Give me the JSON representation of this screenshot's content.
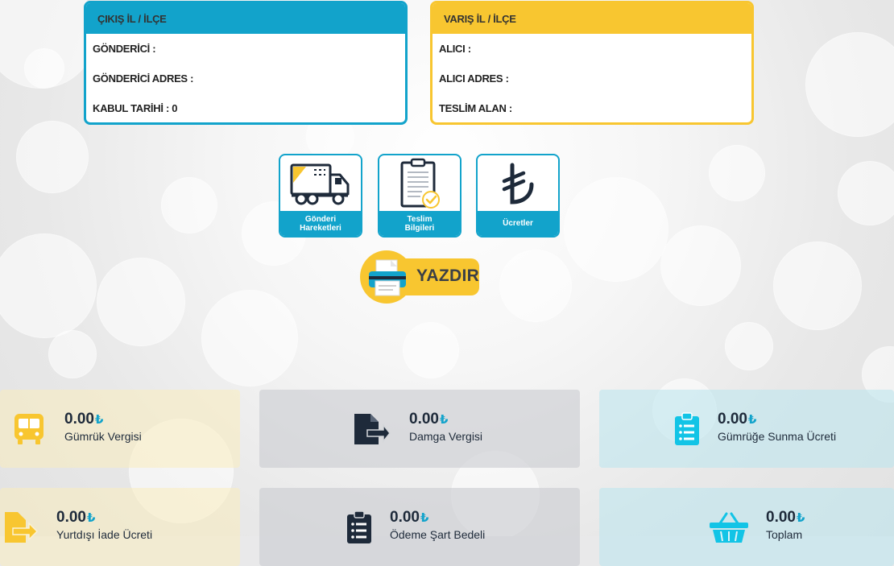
{
  "origin": {
    "header": "ÇIKIŞ İL / İLÇE",
    "rows": [
      "GÖNDERİCİ :",
      "GÖNDERİCİ ADRES :",
      "KABUL TARİHİ : 0"
    ]
  },
  "destination": {
    "header": "VARIŞ İL / İLÇE",
    "rows": [
      "ALICI :",
      "ALICI ADRES :",
      "TESLİM ALAN :"
    ]
  },
  "actions": [
    {
      "label_line1": "Gönderi",
      "label_line2": "Hareketleri",
      "icon": "truck-icon"
    },
    {
      "label_line1": "Teslim",
      "label_line2": "Bilgileri",
      "icon": "clipboard-check-icon"
    },
    {
      "label_line1": "Ücretler",
      "label_line2": "",
      "icon": "lira-icon"
    }
  ],
  "print": {
    "label": "YAZDIR",
    "icon": "printer-icon"
  },
  "currency_symbol": "₺",
  "stats": [
    {
      "value": "0.00",
      "label": "Gümrük Vergisi",
      "icon": "bus-icon"
    },
    {
      "value": "0.00",
      "label": "Damga Vergisi",
      "icon": "document-export-icon"
    },
    {
      "value": "0.00",
      "label": "Gümrüğe Sunma Ücreti",
      "icon": "clipboard-list-icon"
    },
    {
      "value": "0.00",
      "label": "Yurtdışı İade Ücreti",
      "icon": "file-arrow-icon"
    },
    {
      "value": "0.00",
      "label": "Ödeme Şart Bedeli",
      "icon": "clipboard-list-icon"
    },
    {
      "value": "0.00",
      "label": "Toplam",
      "icon": "basket-icon"
    }
  ],
  "colors": {
    "blue": "#12a3cb",
    "yellow": "#f8c630",
    "navy": "#1e2a3a"
  }
}
